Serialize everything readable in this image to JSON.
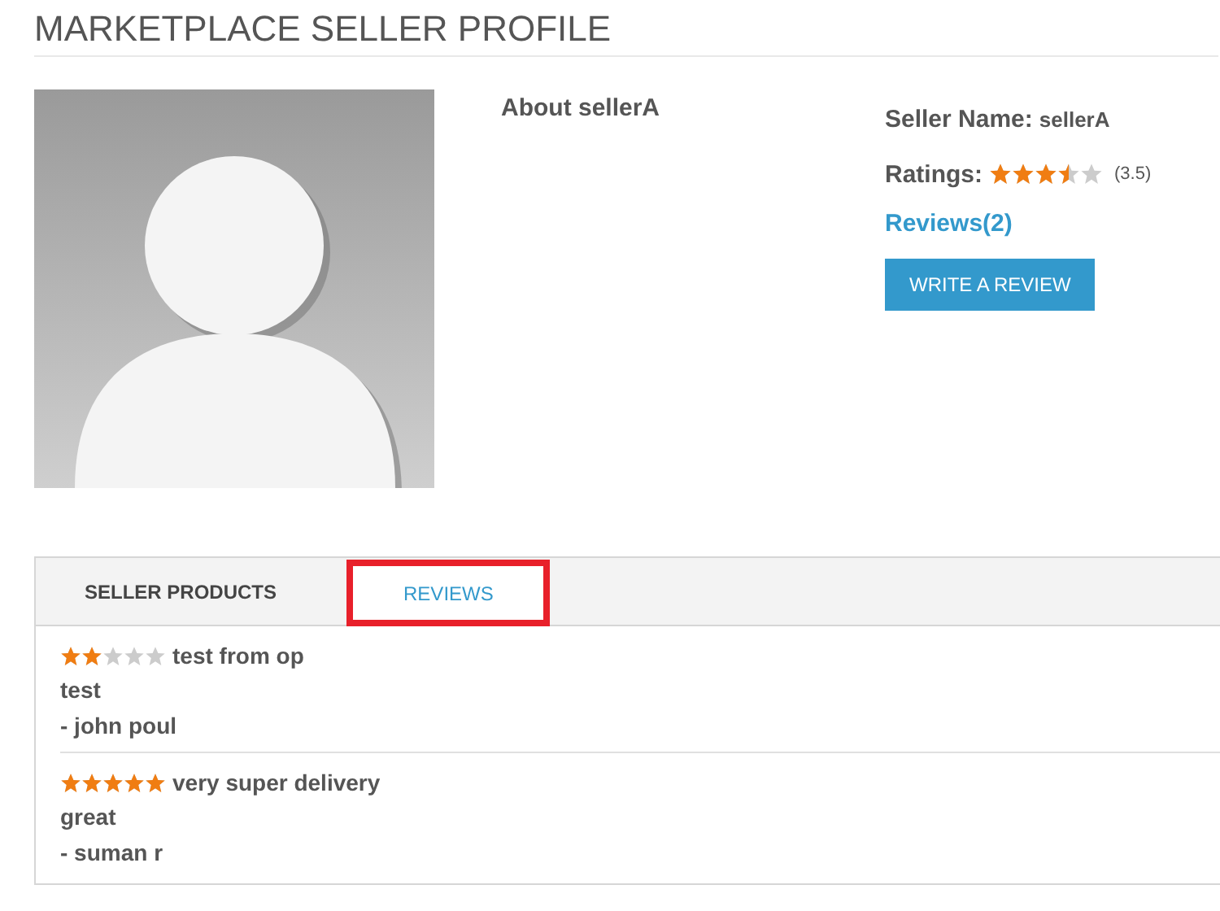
{
  "page_title": "MARKETPLACE SELLER PROFILE",
  "about": "About sellerA",
  "seller": {
    "name_label": "Seller Name:",
    "name": "sellerA",
    "ratings_label": "Ratings:",
    "stars": 3.5,
    "rating_text": "(3.5)",
    "reviews_link": "Reviews(2)",
    "write_button": "WRITE A REVIEW"
  },
  "tabs": [
    {
      "label": "SELLER PRODUCTS",
      "selected": false,
      "highlighted": false
    },
    {
      "label": "REVIEWS",
      "selected": true,
      "highlighted": true
    }
  ],
  "reviews": [
    {
      "stars": 2,
      "title": "test from op",
      "body": "test",
      "author": "- john poul"
    },
    {
      "stars": 5,
      "title": "very super delivery",
      "body": "great",
      "author": "- suman r"
    }
  ]
}
